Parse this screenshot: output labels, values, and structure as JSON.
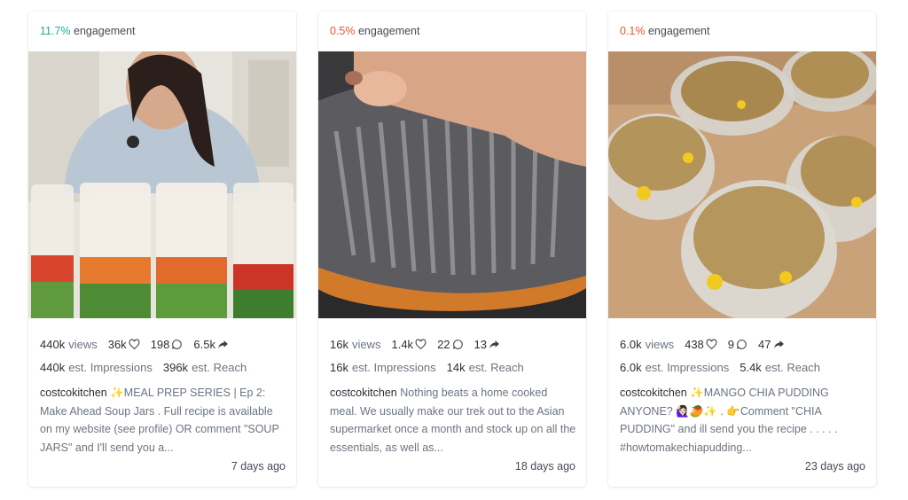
{
  "posts": [
    {
      "engagement_pct": "11.7%",
      "engagement_label": "engagement",
      "engagement_level": "high",
      "views": "440k",
      "views_label": "views",
      "likes": "36k",
      "comments": "198",
      "shares": "6.5k",
      "impressions": "440k",
      "impressions_label": "est. Impressions",
      "reach": "396k",
      "reach_label": "est. Reach",
      "username": "costcokitchen",
      "caption": "✨MEAL PREP SERIES | Ep 2: Make Ahead Soup Jars . Full recipe is available on my website (see profile) OR comment \"SOUP JARS\" and I'll send you a...",
      "date": "7 days ago"
    },
    {
      "engagement_pct": "0.5%",
      "engagement_label": "engagement",
      "engagement_level": "low",
      "views": "16k",
      "views_label": "views",
      "likes": "1.4k",
      "comments": "22",
      "shares": "13",
      "impressions": "16k",
      "impressions_label": "est. Impressions",
      "reach": "14k",
      "reach_label": "est. Reach",
      "username": "costcokitchen",
      "caption": "Nothing beats a home cooked meal. We usually make our trek out to the Asian supermarket once a month and stock up on all the essentials, as well as...",
      "date": "18 days ago"
    },
    {
      "engagement_pct": "0.1%",
      "engagement_label": "engagement",
      "engagement_level": "low",
      "views": "6.0k",
      "views_label": "views",
      "likes": "438",
      "comments": "9",
      "shares": "47",
      "impressions": "6.0k",
      "impressions_label": "est. Impressions",
      "reach": "5.4k",
      "reach_label": "est. Reach",
      "username": "costcokitchen",
      "caption": "✨MANGO CHIA PUDDING ANYONE? 🙋🏻‍♀️🥭✨ . 👉Comment \"CHIA PUDDING\" and ill send you the recipe . . . . . #howtomakechiapudding...",
      "date": "23 days ago"
    }
  ],
  "colors": {
    "engagement_high": "#21a99b",
    "engagement_low": "#e4572e"
  },
  "icons": {
    "likes": "heart-icon",
    "comments": "comment-icon",
    "shares": "share-icon"
  }
}
